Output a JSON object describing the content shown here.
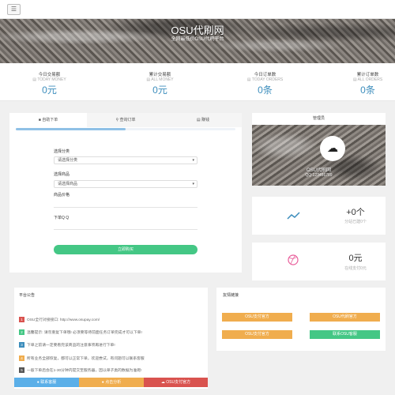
{
  "topbar": {
    "menu_icon": "menu-icon",
    "menu_glyph": "☰"
  },
  "hero": {
    "title": "OSU代刷网",
    "subtitle": "全网最低价OSU代刷平台"
  },
  "stats": [
    {
      "label": "今日交易额",
      "sub": "TODAY MONEY",
      "value": "0元"
    },
    {
      "label": "累计交易额",
      "sub": "ALL MONEY",
      "value": "0元"
    },
    {
      "label": "今日订单数",
      "sub": "TODAY ORDERS",
      "value": "0条"
    },
    {
      "label": "累计订单数",
      "sub": "ALL ORDERS",
      "value": "0条"
    }
  ],
  "tabs": [
    {
      "label": "自助下单",
      "icon": "cart-icon",
      "glyph": "🛒"
    },
    {
      "label": "查询订单",
      "icon": "search-icon",
      "glyph": "🔍"
    },
    {
      "label": "赚钱",
      "icon": "money-icon",
      "glyph": "▤"
    }
  ],
  "tab_progress": 0.5,
  "form": {
    "category_label": "选择分类",
    "category_value": "请选择分类",
    "product_label": "选择商品",
    "product_value": "请选择商品",
    "price_label": "商品价格",
    "qq_label": "下单Q Q",
    "submit_label": "立即购买"
  },
  "admin": {
    "header": "管理员",
    "name": "OSU代刷网",
    "qq": "QQ:123456789",
    "avatar_icon": "avatar-icon"
  },
  "info_cards": [
    {
      "num": "+0个",
      "sub": "分站已建0个",
      "icon": "trend-icon",
      "color": "#3c8dbc"
    },
    {
      "num": "0元",
      "sub": "在线支付0元",
      "icon": "dribbble-icon",
      "color": "#e95e9b"
    }
  ],
  "announce": {
    "title": "平台公告",
    "items": [
      {
        "n": "1",
        "text": "OSU全行对接接口: http://www.osupay.com/",
        "color": "#d9534f"
      },
      {
        "n": "2",
        "text": "温馨提示: 请勿重复下单哦! 必须要等待前面任务订单完成才可以下单!",
        "color": "#44c785"
      },
      {
        "n": "3",
        "text": "下单之前请一定要看完该商品的注意事项再进行下单!",
        "color": "#3c8dbc"
      },
      {
        "n": "4",
        "text": "所有业务全部恢复，都可以正常下单，欢迎尝试，有问题可以联系客服",
        "color": "#f0ad4e"
      },
      {
        "n": "5",
        "text": "一般下单后会在1-30分钟内提交至服务器，因以单子类的数据为准呢!",
        "color": "#555555"
      }
    ],
    "buttons": [
      {
        "label": "联系客服",
        "color": "#5bafe8"
      },
      {
        "label": "点击分析",
        "color": "#f0ad4e"
      },
      {
        "label": "OSU支付官方",
        "color": "#d9534f"
      }
    ]
  },
  "links": {
    "title": "友情链接",
    "items": [
      {
        "label": "OSU支付官方",
        "color": "#f0ad4e"
      },
      {
        "label": "OSU代刷官方",
        "color": "#f0ad4e"
      },
      {
        "label": "OSU支付官方",
        "color": "#f0ad4e"
      },
      {
        "label": "联系OSU客服",
        "color": "#44c785"
      }
    ]
  }
}
